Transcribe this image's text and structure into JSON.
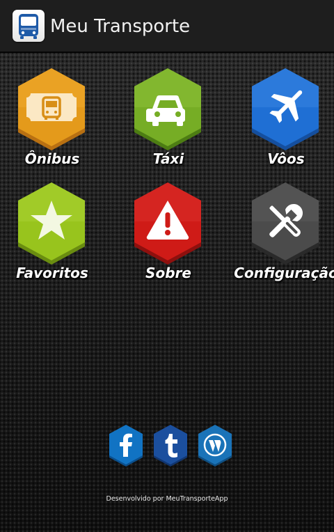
{
  "app": {
    "title": "Meu Transporte",
    "icon": "bus-icon"
  },
  "menu": [
    {
      "label": "Ônibus",
      "icon": "bus-ticket-icon",
      "color": "#e49a1b"
    },
    {
      "label": "Táxi",
      "icon": "car-icon",
      "color": "#76ad25"
    },
    {
      "label": "Vôos",
      "icon": "airplane-icon",
      "color": "#1f6fd4"
    },
    {
      "label": "Favoritos",
      "icon": "star-icon",
      "color": "#98c41d"
    },
    {
      "label": "Sobre",
      "icon": "warning-icon",
      "color": "#cf1b17"
    },
    {
      "label": "Configuração",
      "icon": "tools-icon",
      "color": "#4b4b4b"
    }
  ],
  "social": [
    {
      "icon": "facebook-icon",
      "color": "#1173c3"
    },
    {
      "icon": "tumblr-icon",
      "color": "#1b4f9e"
    },
    {
      "icon": "wordpress-icon",
      "color": "#1a73b8"
    }
  ],
  "footer": {
    "text": "Desenvolvido por MeuTransporteApp"
  }
}
